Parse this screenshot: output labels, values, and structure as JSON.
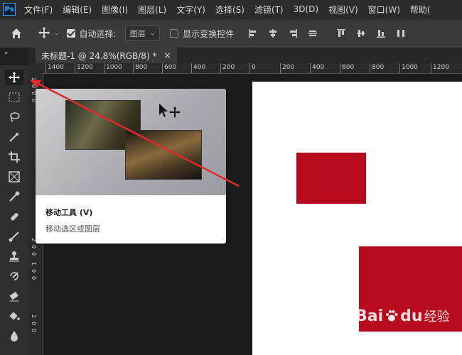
{
  "app": {
    "logo": "Ps"
  },
  "menu": [
    "文件(F)",
    "编辑(E)",
    "图像(I)",
    "图层(L)",
    "文字(Y)",
    "选择(S)",
    "滤镜(T)",
    "3D(D)",
    "视图(V)",
    "窗口(W)",
    "帮助("
  ],
  "options": {
    "auto_select_label": "自动选择:",
    "auto_select_checked": true,
    "auto_select_target": "图层",
    "show_transform_label": "显示变换控件",
    "show_transform_checked": false
  },
  "document_tab": {
    "title": "未标题-1 @ 24.8%(RGB/8) *",
    "close": "×"
  },
  "ruler": {
    "horizontal": [
      "1400",
      "1200",
      "1000",
      "800",
      "600",
      "400",
      "200",
      "0",
      "200",
      "400",
      "600",
      "800",
      "1000",
      "1200"
    ],
    "vertical": [
      "2",
      "0",
      "0",
      "0",
      "2",
      "0",
      "0",
      "1",
      "0",
      "0",
      "2",
      "0",
      "0"
    ]
  },
  "tooltip": {
    "title": "移动工具 (V)",
    "description": "移动选区或图层"
  },
  "canvas_colors": {
    "background": "#ffffff",
    "shape": "#b80a1d"
  },
  "watermark": {
    "brand": "Bai",
    "brand2": "du",
    "suffix": "经验"
  },
  "icons": [
    "home-icon",
    "move-tool-icon",
    "marquee-tool-icon",
    "lasso-tool-icon",
    "quick-select-tool-icon",
    "crop-tool-icon",
    "frame-tool-icon",
    "eyedropper-tool-icon",
    "healing-brush-icon",
    "brush-tool-icon",
    "stamp-tool-icon",
    "history-brush-icon",
    "eraser-tool-icon",
    "paint-bucket-icon",
    "blur-tool-icon",
    "dodge-tool-icon"
  ]
}
